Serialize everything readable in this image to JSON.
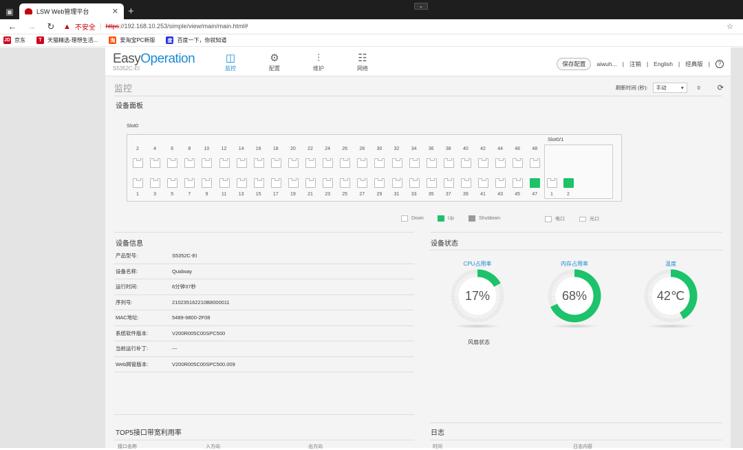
{
  "browser": {
    "tab_title": "LSW Web管理平台",
    "not_secure": "不安全",
    "url_scheme": "https",
    "url_rest": "://192.168.10.253/simple/view/main/main.html#",
    "bookmarks": [
      "京东",
      "天猫精选-理想生活...",
      "爱淘宝PC新版",
      "百度一下，你就知道"
    ]
  },
  "header": {
    "logo_easy": "Easy",
    "logo_operation": "Operation",
    "model": "S5352C-EI",
    "nav": [
      {
        "label": "监控",
        "icon": "monitor-chart-icon"
      },
      {
        "label": "配置",
        "icon": "gear-icon"
      },
      {
        "label": "维护",
        "icon": "sliders-icon"
      },
      {
        "label": "网络",
        "icon": "network-topology-icon"
      }
    ],
    "save_label": "保存配置",
    "user": "aiwuh...",
    "logout": "注销",
    "language": "English",
    "classic": "经典版"
  },
  "page": {
    "title": "监控",
    "refresh_label": "刷新时间 (秒):",
    "refresh_mode": "手动",
    "refresh_value": "0"
  },
  "device_panel": {
    "title": "设备面板",
    "slot0": "Slot0",
    "slot01": "Slot0/1",
    "top_ports": [
      "2",
      "4",
      "6",
      "8",
      "10",
      "12",
      "14",
      "16",
      "18",
      "20",
      "22",
      "24",
      "26",
      "28",
      "30",
      "32",
      "34",
      "36",
      "38",
      "40",
      "42",
      "44",
      "46",
      "48"
    ],
    "bottom_ports": [
      "1",
      "3",
      "5",
      "7",
      "9",
      "11",
      "13",
      "15",
      "17",
      "19",
      "21",
      "23",
      "25",
      "27",
      "29",
      "31",
      "33",
      "35",
      "37",
      "39",
      "41",
      "43",
      "45",
      "47"
    ],
    "up_ports": [
      "47"
    ],
    "slot_ports": [
      {
        "label": "1",
        "up": false
      },
      {
        "label": "2",
        "up": true
      }
    ],
    "legend": {
      "down": "Down",
      "up": "Up",
      "shutdown": "Shutdown",
      "electric": "电口",
      "optical": "光口"
    }
  },
  "device_info": {
    "title": "设备信息",
    "rows": [
      {
        "k": "产品型号:",
        "v": "S5352C-EI"
      },
      {
        "k": "设备名称:",
        "v": "Quidway"
      },
      {
        "k": "运行时间:",
        "v": "6分钟37秒"
      },
      {
        "k": "序列号:",
        "v": "210235162210B8000011"
      },
      {
        "k": "MAC地址:",
        "v": "5489-9800-2F08"
      },
      {
        "k": "系统软件版本:",
        "v": "V200R005C00SPC500"
      },
      {
        "k": "当前运行补丁:",
        "v": "---"
      },
      {
        "k": "Web网管版本:",
        "v": "V200R005C00SPC500.009"
      }
    ]
  },
  "device_status": {
    "title": "设备状态",
    "gauges": [
      {
        "label": "CPU占用率",
        "value_text": "17%",
        "value": 0.17
      },
      {
        "label": "内存占用率",
        "value_text": "68%",
        "value": 0.68
      },
      {
        "label": "温度",
        "value_text": "42℃",
        "value": 0.42
      }
    ],
    "fan_label": "风扇状态",
    "accent": "#1cc36a"
  },
  "top5": {
    "title": "TOP5接口带宽利用率",
    "cols": [
      "接口名称",
      "入方向",
      "出方向"
    ]
  },
  "log": {
    "title": "日志",
    "cols": [
      "时间",
      "日志内容"
    ]
  }
}
